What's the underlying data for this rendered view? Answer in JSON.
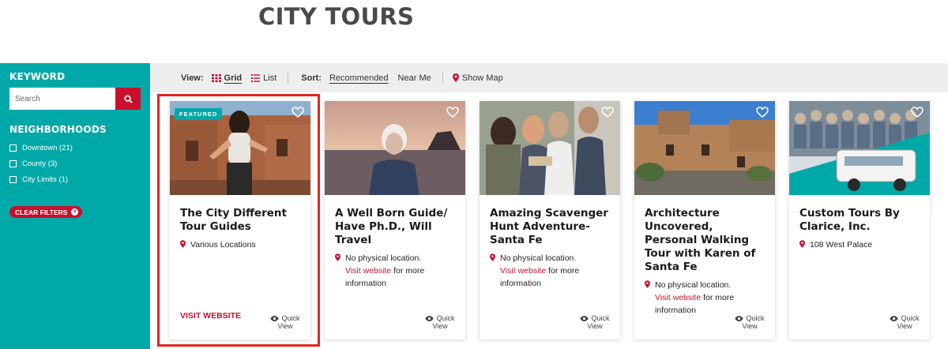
{
  "page_title": "CITY TOURS",
  "sidebar": {
    "keyword_heading": "KEYWORD",
    "search_placeholder": "Search",
    "neighborhoods_heading": "NEIGHBORHOODS",
    "neighborhoods": [
      {
        "label": "Downtown (21)"
      },
      {
        "label": "County (3)"
      },
      {
        "label": "City Limits (1)"
      }
    ],
    "clear_filters_label": "CLEAR FILTERS"
  },
  "toolbar": {
    "view_label": "View:",
    "grid_label": "Grid",
    "list_label": "List",
    "sort_label": "Sort:",
    "recommended_label": "Recommended",
    "near_me_label": "Near Me",
    "show_map_label": "Show Map"
  },
  "cards": [
    {
      "title": "The City Different Tour Guides",
      "badge": "FEATURED",
      "location": "Various Locations",
      "visit_label": "VISIT WEBSITE",
      "quick_view": "Quick",
      "quick_view_2": "View"
    },
    {
      "title": "A Well Born Guide/ Have Ph.D., Will Travel",
      "location": "No physical location.",
      "link_text": "Visit website",
      "after_link": " for more information",
      "quick_view": "Quick",
      "quick_view_2": "View"
    },
    {
      "title": "Amazing Scavenger Hunt Adventure-Santa Fe",
      "location": "No physical location.",
      "link_text": "Visit website",
      "after_link": " for more information",
      "quick_view": "Quick",
      "quick_view_2": "View"
    },
    {
      "title": "Architecture Uncovered, Personal Walking Tour with Karen of Santa Fe",
      "location": "No physical location.",
      "link_text": "Visit website",
      "after_link": " for more information",
      "quick_view": "Quick",
      "quick_view_2": "View"
    },
    {
      "title": "Custom Tours By Clarice, Inc.",
      "location": "108 West Palace",
      "quick_view": "Quick",
      "quick_view_2": "View"
    }
  ],
  "colors": {
    "teal": "#00a9a8",
    "red": "#c8102e",
    "highlight": "#e5241b"
  }
}
